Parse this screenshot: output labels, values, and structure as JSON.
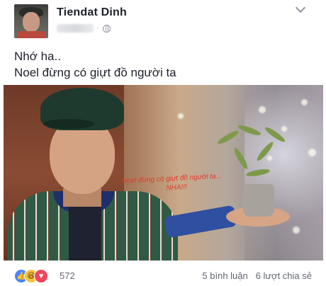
{
  "post": {
    "author": {
      "name": "Tiendat Dinh"
    },
    "meta": {
      "separator": "·",
      "audience_icon": "globe-icon"
    },
    "menu_icon": "chevron-down-icon",
    "text_lines": [
      "Nhớ ha..",
      "Noel đừng có giựt đồ người ta"
    ],
    "image_overlay": {
      "line1": "Noel đừng có giựt đồ người ta...",
      "line2": "NHA!!!",
      "color": "#e23b2a"
    }
  },
  "footer": {
    "reaction_icons": [
      "like-icon",
      "haha-icon",
      "love-icon"
    ],
    "reaction_count": "572",
    "comments": "5 bình luận",
    "shares": "6 lượt chia sẻ"
  },
  "colors": {
    "like": "#4a83ff",
    "haha": "#f7c33d",
    "love": "#f0455d",
    "meta_gray": "#90949c"
  }
}
